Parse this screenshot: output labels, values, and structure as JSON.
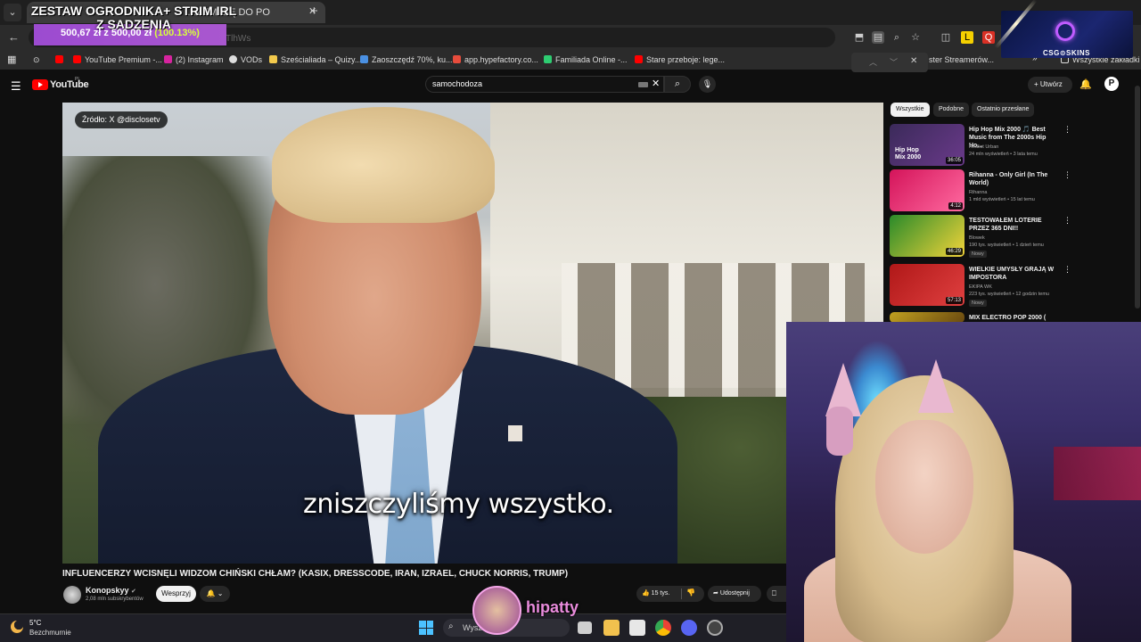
{
  "browser": {
    "active_tab_title": "…ŁEM SIĘ DO PO",
    "url_fragment": "TlhWs",
    "bookmarks": [
      {
        "label": "YouTube Premium -...",
        "color": "#ff0000"
      },
      {
        "label": "(2) Instagram",
        "color": "#d6249f"
      },
      {
        "label": "VODs",
        "color": "#dddddd"
      },
      {
        "label": "Sześcialiada – Quizy...",
        "color": "#f2c94c"
      },
      {
        "label": "Zaoszczędź 70%, ku...",
        "color": "#4a90e2"
      },
      {
        "label": "app.hypefactory.co...",
        "color": "#e74c3c"
      },
      {
        "label": "Familiada Online -...",
        "color": "#2ecc71"
      },
      {
        "label": "Stare przeboje: lege...",
        "color": "#ff0000"
      },
      {
        "label": "ster Streamerów...",
        "color": "#dddddd"
      },
      {
        "label": "Wszystkie zakładki",
        "color": "#dddddd"
      }
    ]
  },
  "youtube": {
    "logo_text": "YouTube",
    "region": "PL",
    "search_query": "samochodoza",
    "create_label": "Utwórz",
    "avatar_letter": "P"
  },
  "video": {
    "source_badge": "Źródło: X @disclosetv",
    "subtitle": "zniszczyliśmy wszystko.",
    "title": "INFLUENCERZY WCISNĘLI WIDZOM CHIŃSKI CHŁAM? (KASIX, DRESSCODE, IRAN, IZRAEL, CHUCK NORRIS, TRUMP)",
    "channel_name": "Konopskyy",
    "channel_subs": "2,08 mln subskrybentów",
    "support_label": "Wesprzyj",
    "likes": "15 tys.",
    "share_label": "Udostępnij"
  },
  "sidebar": {
    "chips": [
      "Wszystkie",
      "Podobne",
      "Ostatnio przesłane"
    ],
    "recommendations": [
      {
        "title": "Hip Hop Mix 2000 🎵 Best Music from The 2000s Hip Ho...",
        "channel": "Redlist Urban",
        "meta": "24 mln wyświetleń • 3 lata temu",
        "duration": "36:05",
        "thumb_text": "Hip Hop Mix 2000",
        "tag": "",
        "colors": [
          "#3b2a5a",
          "#6a3a8a"
        ]
      },
      {
        "title": "Rihanna - Only Girl (In The World)",
        "channel": "Rihanna",
        "meta": "1 mld wyświetleń • 15 lat temu",
        "duration": "4:12",
        "thumb_text": "",
        "tag": "",
        "colors": [
          "#d4145a",
          "#ff6aa0"
        ]
      },
      {
        "title": "TESTOWAŁEM LOTERIE PRZEZ 365 DNI!!",
        "channel": "Blowek",
        "meta": "190 tys. wyświetleń • 1 dzień temu",
        "duration": "46:29",
        "thumb_text": "",
        "tag": "Nowy",
        "colors": [
          "#2a8a2a",
          "#f2d43a"
        ]
      },
      {
        "title": "WIELKIE UMYSŁY GRAJĄ W IMPOSTORA",
        "channel": "EKIPA WK",
        "meta": "223 tys. wyświetleń • 12 godzin temu",
        "duration": "57:13",
        "thumb_text": "",
        "tag": "Nowy",
        "colors": [
          "#b01818",
          "#e04040"
        ]
      },
      {
        "title": "MIX ELECTRO POP 2000 (",
        "channel": "",
        "meta": "",
        "duration": "",
        "thumb_text": "",
        "tag": "",
        "colors": [
          "#c0a020",
          "#6a4a10"
        ]
      }
    ]
  },
  "overlay": {
    "donation_title": "ZESTAW OGRODNIKA+ STRIM IRL Z SADZENIA",
    "donation_amount": "500,67 zł z 500,00 zł",
    "donation_percent": "(100.13%)",
    "sponsor": "CSG⊙SKINS",
    "streamer_name": "hipatty"
  },
  "taskbar": {
    "temperature": "5°C",
    "weather": "Bezchmurnie",
    "search_placeholder": "Wysz"
  }
}
